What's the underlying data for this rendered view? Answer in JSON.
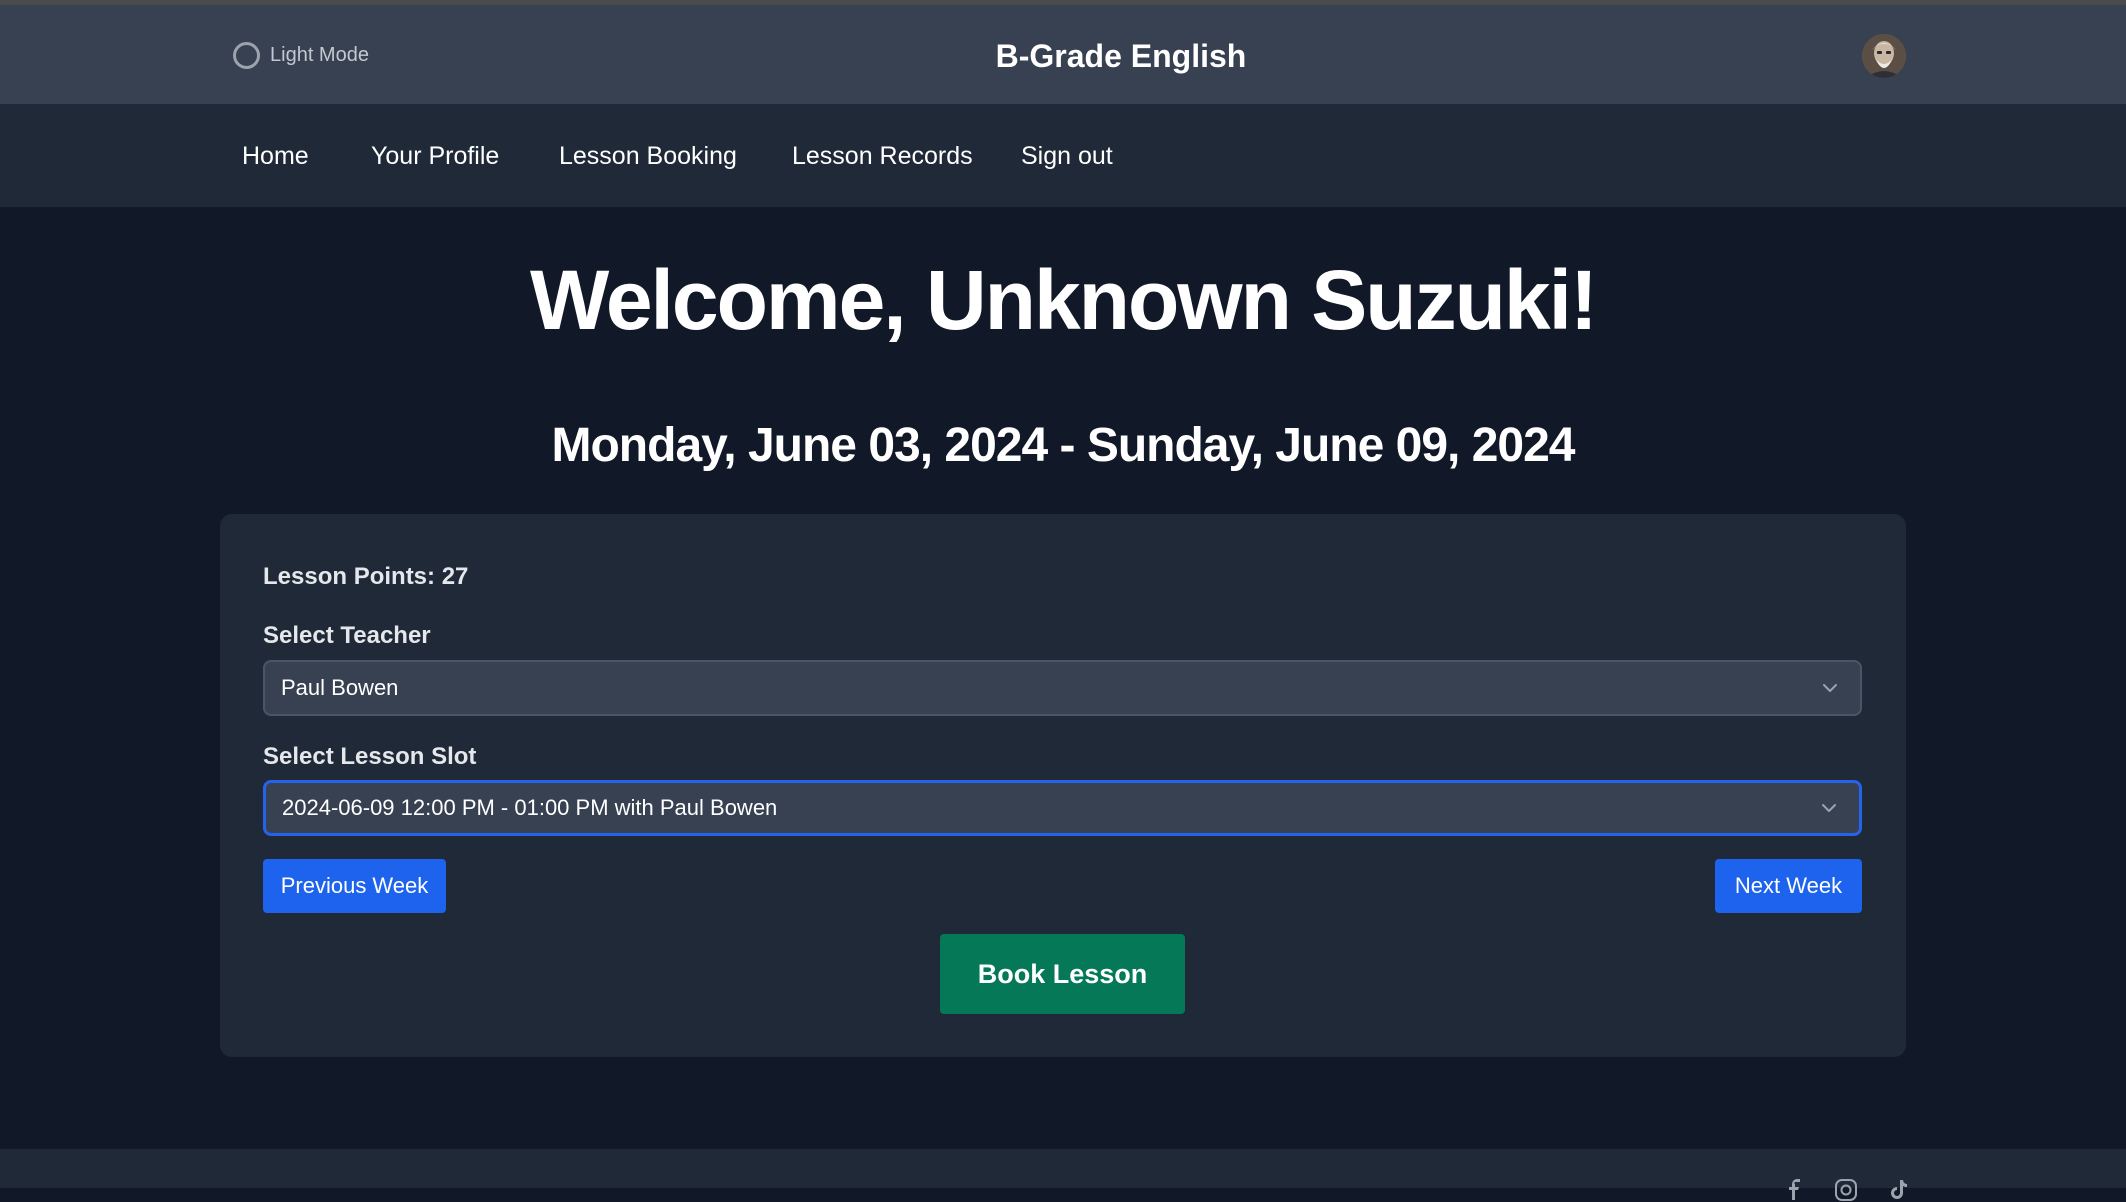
{
  "header": {
    "mode_toggle_label": "Light Mode",
    "site_title": "B-Grade English"
  },
  "nav": {
    "items": [
      {
        "label": "Home"
      },
      {
        "label": "Your Profile"
      },
      {
        "label": "Lesson Booking"
      },
      {
        "label": "Lesson Records"
      },
      {
        "label": "Sign out"
      }
    ]
  },
  "main": {
    "welcome": "Welcome, Unknown Suzuki!",
    "week_range": "Monday, June 03, 2024 - Sunday, June 09, 2024",
    "lesson_points": "Lesson Points: 27",
    "teacher_label": "Select Teacher",
    "teacher_value": "Paul Bowen",
    "slot_label": "Select Lesson Slot",
    "slot_value": "2024-06-09 12:00 PM - 01:00 PM with Paul Bowen",
    "prev_week": "Previous Week",
    "next_week": "Next Week",
    "book_lesson": "Book Lesson"
  },
  "footer": {
    "icons": [
      "facebook-icon",
      "instagram-icon",
      "tiktok-icon"
    ]
  },
  "colors": {
    "page_bg": "#111827",
    "header_bg": "#374151",
    "nav_bg": "#1f2937",
    "card_bg": "#1f2937",
    "primary_blue": "#1d63ed",
    "book_green": "#047857",
    "focus_ring": "#2563eb"
  }
}
